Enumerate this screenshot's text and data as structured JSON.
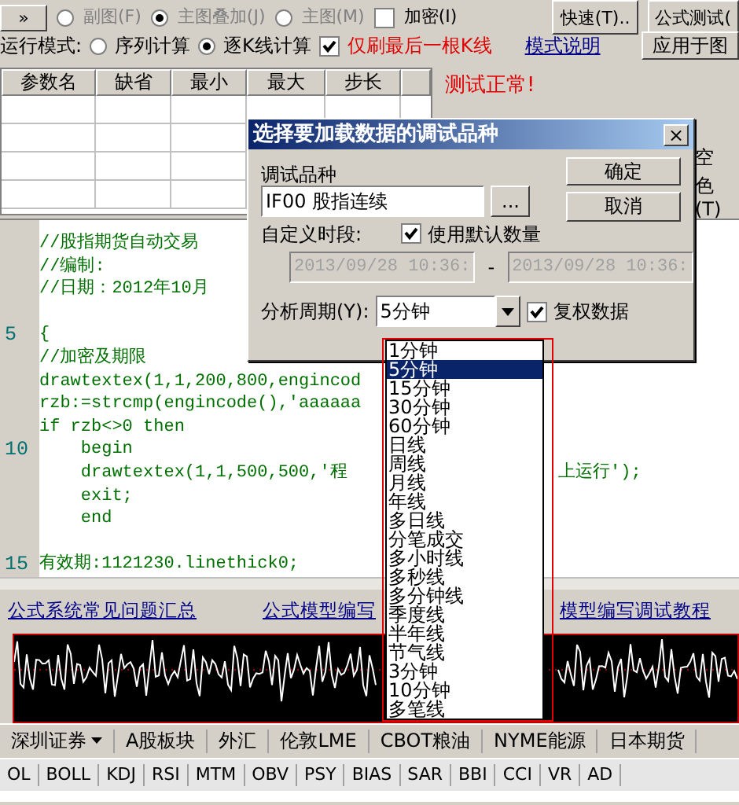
{
  "toolbar": {
    "more_button": "»",
    "chart_options": [
      {
        "label": "副图(F)",
        "selected": false
      },
      {
        "label": "主图叠加(J)",
        "selected": true
      },
      {
        "label": "主图(M)",
        "selected": false
      }
    ],
    "encrypt": {
      "label": "加密(I)",
      "checked": false
    },
    "buttons": [
      "快速(T)..",
      "公式测试("
    ]
  },
  "run_mode": {
    "label": "运行模式:",
    "options": [
      {
        "label": "序列计算",
        "selected": false
      },
      {
        "label": "逐K线计算",
        "selected": true
      }
    ],
    "refresh_last": {
      "label": "仅刷最后一根K线",
      "checked": true
    },
    "help_link": "模式说明",
    "apply_button": "应用于图"
  },
  "params_table": {
    "columns": [
      "参数名",
      "缺省",
      "最小",
      "最大",
      "步长"
    ]
  },
  "test_status": "测试正常!",
  "right_panel": [
    "空",
    "色(T)"
  ],
  "editor": {
    "lines": [
      {
        "kind": "code",
        "text": "//股指期货自动交易"
      },
      {
        "kind": "code",
        "text": "//编制:"
      },
      {
        "kind": "code",
        "text": "//日期：2012年10月"
      },
      {
        "kind": "blank"
      },
      {
        "kind": "code",
        "number": "5",
        "text": "{"
      },
      {
        "kind": "code",
        "text": "//加密及期限"
      },
      {
        "kind": "code",
        "text": "drawtextex(1,1,200,800,engincod"
      },
      {
        "kind": "code",
        "text": "rzb:=strcmp(engincode(),'aaaaaa"
      },
      {
        "kind": "code",
        "text": "if rzb<>0 then"
      },
      {
        "kind": "code",
        "number": "10",
        "text": "    begin"
      },
      {
        "kind": "code",
        "text": "    drawtextex(1,1,500,500,'程",
        "tail": "上运行');"
      },
      {
        "kind": "code",
        "text": "    exit;"
      },
      {
        "kind": "code",
        "text": "    end"
      },
      {
        "kind": "blank"
      },
      {
        "kind": "code",
        "number": "15",
        "text": "有效期:1121230.linethick0;"
      }
    ]
  },
  "links": [
    "公式系统常见问题汇总",
    "公式模型编写",
    "模型编写调试教程"
  ],
  "market_tabs": [
    {
      "label": "深圳证券",
      "dropdown": true
    },
    {
      "label": "A股板块",
      "dropdown": false
    },
    {
      "label": "外汇",
      "dropdown": false
    },
    {
      "label": "伦敦LME",
      "dropdown": false
    },
    {
      "label": "CBOT粮油",
      "dropdown": false
    },
    {
      "label": "NYME能源",
      "dropdown": false
    },
    {
      "label": "日本期货",
      "dropdown": false
    }
  ],
  "indicator_tabs": [
    "OL",
    "BOLL",
    "KDJ",
    "RSI",
    "MTM",
    "OBV",
    "PSY",
    "BIAS",
    "SAR",
    "BBI",
    "CCI",
    "VR",
    "AD"
  ],
  "dialog": {
    "title": "选择要加载数据的调试品种",
    "close": "×",
    "symbol_label": "调试品种",
    "symbol_value": "IF00 股指连续",
    "browse_button": "...",
    "ok_button": "确定",
    "cancel_button": "取消",
    "custom_period_label": "自定义时段:",
    "use_default": {
      "label": "使用默认数量",
      "checked": true
    },
    "start_time": "2013/09/28 10:36:",
    "dash": "-",
    "end_time": "2013/09/28 10:36:",
    "period_label": "分析周期(Y):",
    "period_value": "5分钟",
    "adjusted": {
      "label": "复权数据",
      "checked": true
    },
    "period_options": [
      {
        "label": "1分钟",
        "selected": false
      },
      {
        "label": "5分钟",
        "selected": true
      },
      {
        "label": "15分钟",
        "selected": false
      },
      {
        "label": "30分钟",
        "selected": false
      },
      {
        "label": "60分钟",
        "selected": false
      },
      {
        "label": "日线",
        "selected": false
      },
      {
        "label": "周线",
        "selected": false
      },
      {
        "label": "月线",
        "selected": false
      },
      {
        "label": "年线",
        "selected": false
      },
      {
        "label": "多日线",
        "selected": false
      },
      {
        "label": "分笔成交",
        "selected": false
      },
      {
        "label": "多小时线",
        "selected": false
      },
      {
        "label": "多秒线",
        "selected": false
      },
      {
        "label": "多分钟线",
        "selected": false
      },
      {
        "label": "季度线",
        "selected": false
      },
      {
        "label": "半年线",
        "selected": false
      },
      {
        "label": "节气线",
        "selected": false
      },
      {
        "label": "3分钟",
        "selected": false
      },
      {
        "label": "10分钟",
        "selected": false
      },
      {
        "label": "多笔线",
        "selected": false
      }
    ]
  }
}
